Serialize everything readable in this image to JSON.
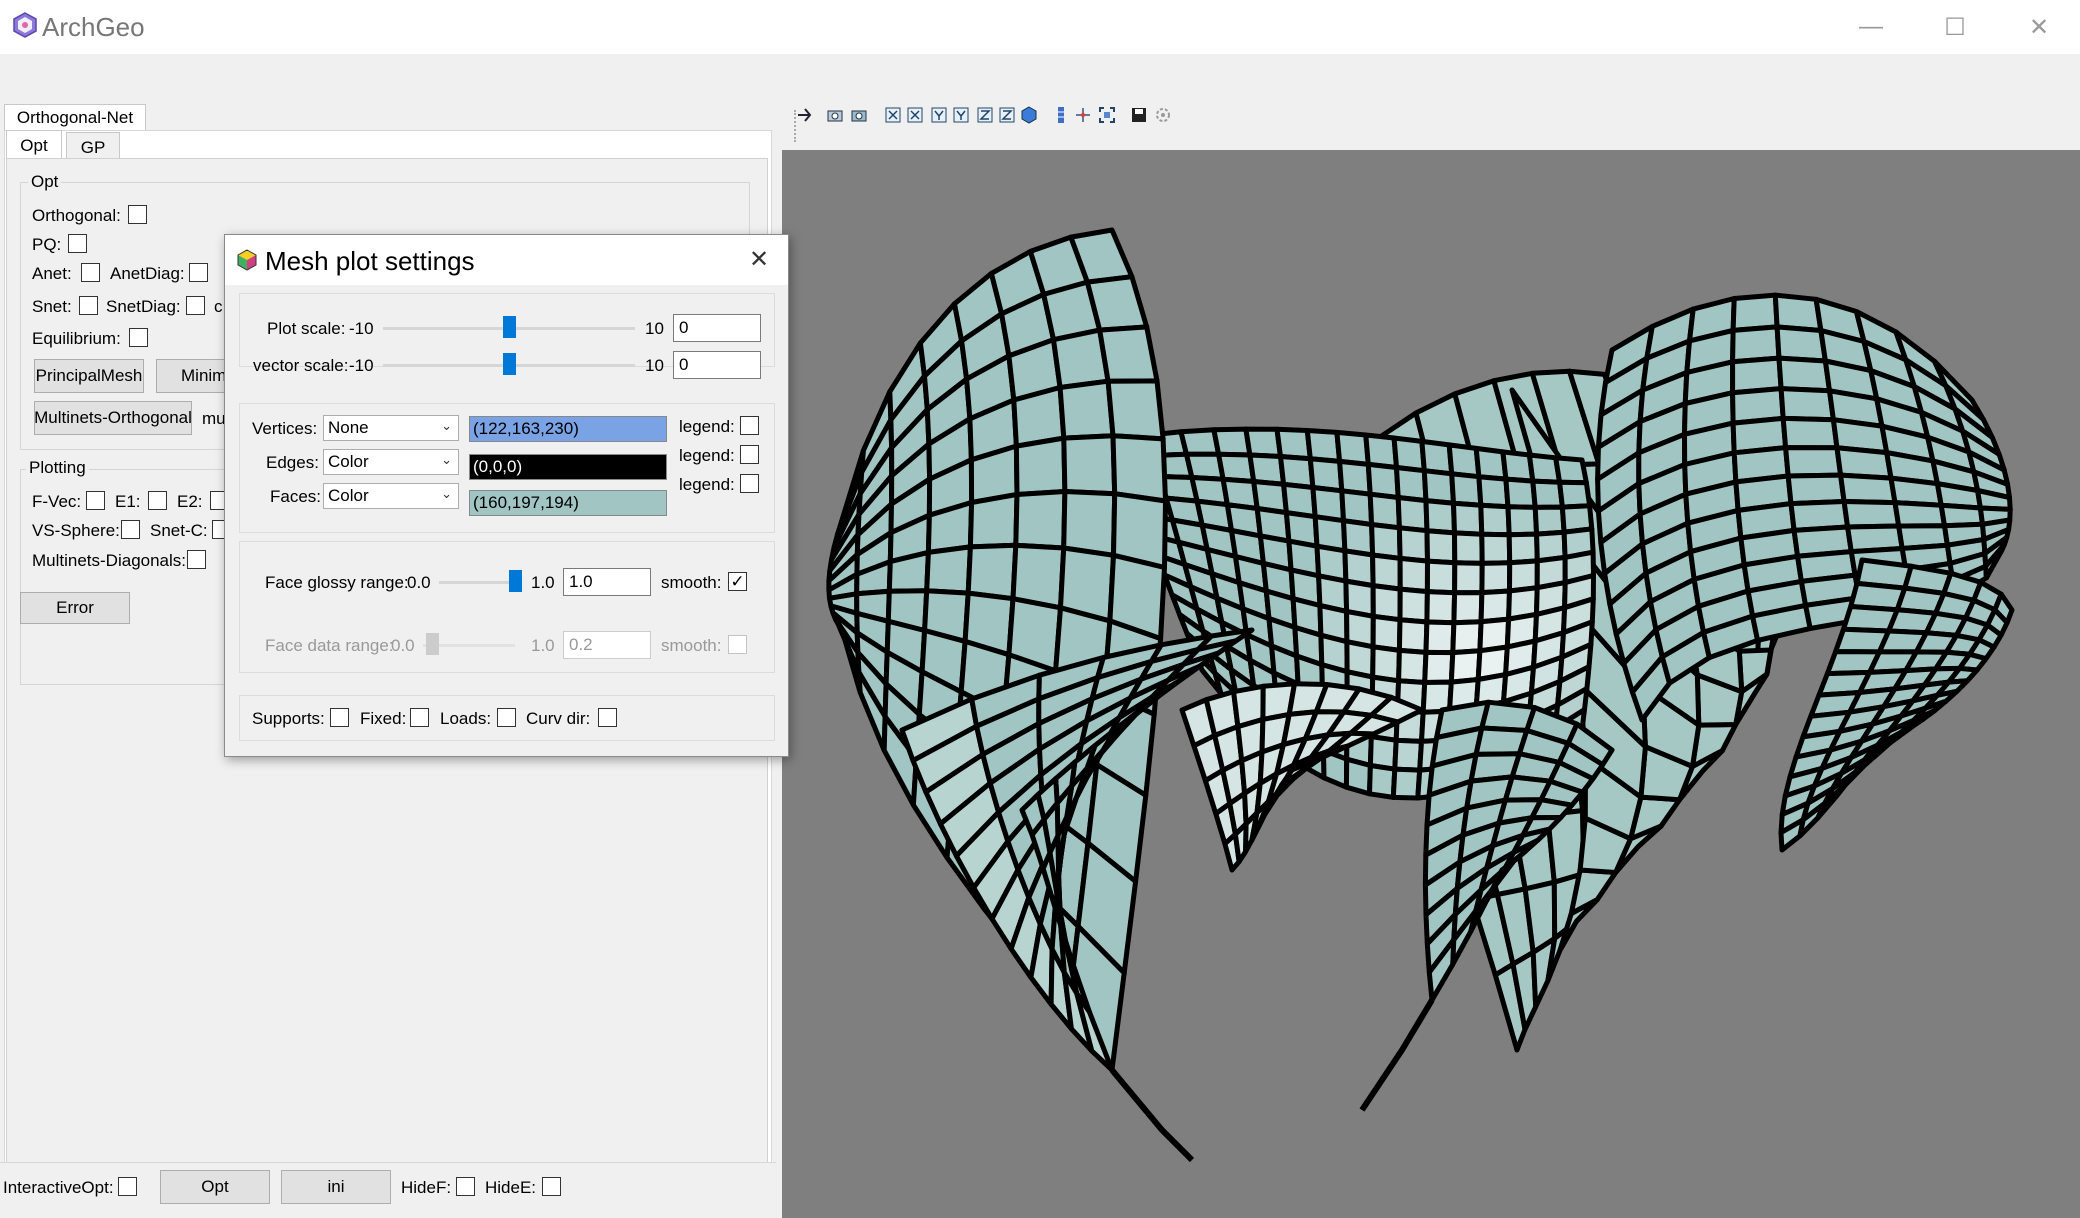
{
  "window": {
    "title": "ArchGeo",
    "minimize_glyph": "—",
    "maximize_glyph": "☐",
    "close_glyph": "✕"
  },
  "main_toolbar": {
    "icons": [
      "cube-icon",
      "dot-icon",
      "pencil-icon",
      "triangle-icon",
      "link-icon",
      "grid-icon",
      "grid-icon-2",
      "cross-icon",
      "cross-icon-2",
      "person-icon",
      "person-icon-2",
      "figure-icon",
      "plane-icon",
      "plane-icon-2",
      "plane-icon-3",
      "triangle-icon-2",
      "triangle-icon-3",
      "hexagon-icon",
      "sphere-icon",
      "sphere-icon-2",
      "sphere-icon-3",
      "brush-icon",
      "hide-icon",
      "play-icon",
      "window-icon"
    ]
  },
  "left_panel": {
    "top_tab": "Orthogonal-Net",
    "sub_tabs": [
      "Opt",
      "GP"
    ],
    "opt_group": {
      "title": "Opt",
      "orthogonal": "Orthogonal:",
      "pq": "PQ:",
      "anet": "Anet:",
      "anetdiag": "AnetDiag:",
      "snet": "Snet:",
      "snetdiag": "SnetDiag:",
      "snetdiag_cut": "c",
      "equilibrium": "Equilibrium:",
      "principal_mesh": "PrincipalMesh",
      "minimal_cut": "Minim",
      "multinets_orthogonal": "Multinets-Orthogonal",
      "multinets_cut": "mu"
    },
    "plotting_group": {
      "title": "Plotting",
      "fvec": "F-Vec:",
      "e1": "E1:",
      "e2": "E2:",
      "vs_sphere": "VS-Sphere:",
      "snet_c": "Snet-C:",
      "multinets_diagonals": "Multinets-Diagonals:"
    },
    "error_button": "Error",
    "bottom": {
      "interactive_opt": "InteractiveOpt:",
      "opt_button": "Opt",
      "ini_button": "ini",
      "hidef": "HideF:",
      "hidee": "HideE:"
    }
  },
  "viewer_toolbar": {
    "icons": [
      "pointer-icon",
      "camera-icon",
      "camera-icon-2",
      "view-x-icon",
      "view-x-neg-icon",
      "view-y-icon",
      "view-y-neg-icon",
      "view-z-icon",
      "view-z-neg-icon",
      "cube-view-icon",
      "bars-icon",
      "axes-icon",
      "fit-icon",
      "save-icon",
      "settings-icon"
    ]
  },
  "dialog": {
    "title": "Mesh plot settings",
    "close_glyph": "✕",
    "plot_scale": {
      "label": "Plot scale:",
      "min": "-10",
      "max": "10",
      "value": "0",
      "position": 0.5
    },
    "vector_scale": {
      "label": "vector scale:",
      "min": "-10",
      "max": "10",
      "value": "0",
      "position": 0.5
    },
    "vertices": {
      "label": "Vertices:",
      "mode": "None",
      "color_text": "(122,163,230)",
      "color": "#7aa3e6",
      "legend": "legend:"
    },
    "edges": {
      "label": "Edges:",
      "mode": "Color",
      "color_text": "(0,0,0)",
      "color": "#000000",
      "legend": "legend:"
    },
    "faces": {
      "label": "Faces:",
      "mode": "Color",
      "color_text": "(160,197,194)",
      "color": "#a0c5c2",
      "legend": "legend:"
    },
    "glossy": {
      "label": "Face glossy range:",
      "min": "0.0",
      "max": "1.0",
      "value": "1.0",
      "smooth": "smooth:",
      "smooth_checked": true,
      "position": 1.0
    },
    "data_range": {
      "label": "Face data range:",
      "min": "0.0",
      "max": "1.0",
      "value": "0.2",
      "smooth": "smooth:",
      "position": 0.1
    },
    "supports": "Supports:",
    "fixed": "Fixed:",
    "loads": "Loads:",
    "curv_dir": "Curv dir:"
  },
  "viewport": {
    "background": "#7f7f7f",
    "mesh_face_color": "#a0c5c2",
    "mesh_edge_color": "#000000"
  }
}
